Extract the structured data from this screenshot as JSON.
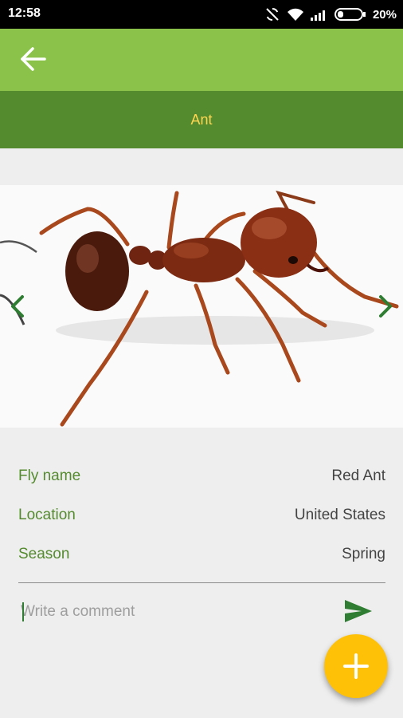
{
  "status_bar": {
    "time": "12:58",
    "battery": "20%",
    "icons": [
      "sync-off-icon",
      "wifi-icon",
      "signal-icon",
      "battery-icon"
    ]
  },
  "app_bar": {
    "back_icon": "arrow-left-icon",
    "color": "#8bc34a"
  },
  "title_bar": {
    "title": "Ant",
    "color": "#558b2f",
    "text_color": "#ffd54f"
  },
  "gallery": {
    "prev_icon": "chevron-left-icon",
    "next_icon": "chevron-right-icon"
  },
  "details": [
    {
      "label": "Fly name",
      "value": "Red Ant"
    },
    {
      "label": "Location",
      "value": "United States"
    },
    {
      "label": "Season",
      "value": "Spring"
    }
  ],
  "comment": {
    "placeholder": "Write a comment",
    "send_icon": "send-icon"
  },
  "fab": {
    "icon": "plus-icon",
    "color": "#ffc107"
  }
}
